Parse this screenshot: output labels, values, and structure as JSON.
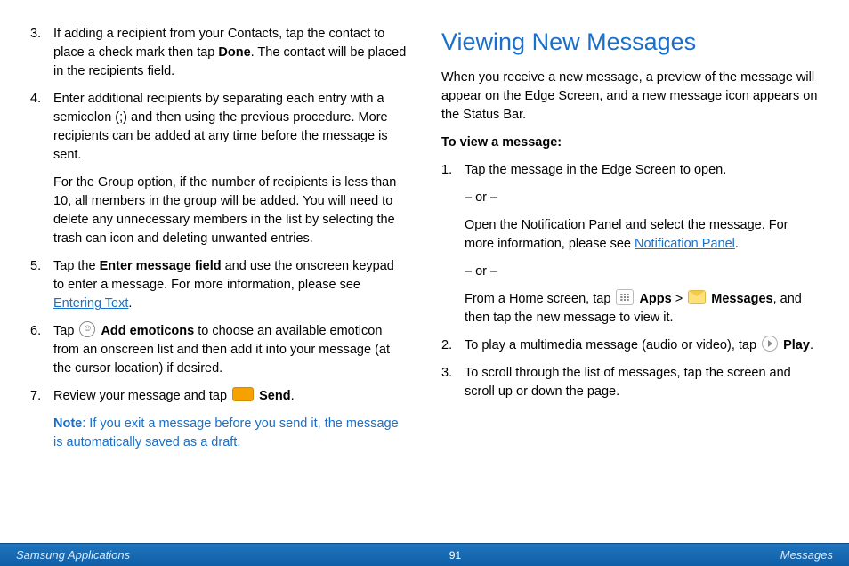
{
  "left": {
    "items": [
      {
        "num": "3.",
        "paras": [
          {
            "runs": [
              {
                "t": "If adding a recipient from your Contacts, tap the contact to place a check mark then tap "
              },
              {
                "t": "Done",
                "bold": true
              },
              {
                "t": ". The contact will be placed in the recipients field."
              }
            ]
          }
        ]
      },
      {
        "num": "4.",
        "paras": [
          {
            "runs": [
              {
                "t": "Enter additional recipients by separating each entry with a semicolon (;) and then using the previous procedure. More recipients can be added at any time before the message is sent."
              }
            ]
          },
          {
            "runs": [
              {
                "t": "For the Group option, if the number of recipients is less than 10, all members in the group will be added. You will need to delete any unnecessary members in the list by selecting the trash can icon and deleting unwanted entries."
              }
            ]
          }
        ]
      },
      {
        "num": "5.",
        "paras": [
          {
            "runs": [
              {
                "t": "Tap the "
              },
              {
                "t": "Enter message field",
                "bold": true
              },
              {
                "t": " and use the onscreen keypad to enter a message. For more information, please see "
              },
              {
                "t": "Entering Text",
                "link": true
              },
              {
                "t": "."
              }
            ]
          }
        ]
      },
      {
        "num": "6.",
        "paras": [
          {
            "runs": [
              {
                "t": "Tap "
              },
              {
                "icon": "emoticon"
              },
              {
                "t": " "
              },
              {
                "t": "Add emoticons",
                "bold": true
              },
              {
                "t": " to choose an available emoticon from an onscreen list and then add it into your message (at the cursor location) if desired."
              }
            ]
          }
        ]
      },
      {
        "num": "7.",
        "paras": [
          {
            "runs": [
              {
                "t": "Review your message and tap "
              },
              {
                "icon": "send"
              },
              {
                "t": " "
              },
              {
                "t": "Send",
                "bold": true
              },
              {
                "t": "."
              }
            ]
          }
        ]
      }
    ],
    "note": {
      "label": "Note",
      "text": ": If you exit a message before you send it, the message is automatically saved as a draft."
    }
  },
  "right": {
    "heading": "Viewing New Messages",
    "intro": "When you receive a new message, a preview of the message will appear on the Edge Screen, and a new message icon appears on the Status Bar.",
    "subheading": "To view a message:",
    "items": [
      {
        "num": "1.",
        "paras": [
          {
            "runs": [
              {
                "t": "Tap the message in the Edge Screen to open."
              }
            ]
          },
          {
            "runs": [
              {
                "t": "– or –"
              }
            ]
          },
          {
            "runs": [
              {
                "t": "Open the Notification Panel and select the message. For more information, please see "
              },
              {
                "t": "Notification Panel",
                "link": true
              },
              {
                "t": "."
              }
            ]
          },
          {
            "runs": [
              {
                "t": "– or –"
              }
            ]
          },
          {
            "runs": [
              {
                "t": "From a Home screen, tap "
              },
              {
                "icon": "apps-grid"
              },
              {
                "t": " "
              },
              {
                "t": "Apps",
                "bold": true
              },
              {
                "t": " > "
              },
              {
                "icon": "messages-envelope"
              },
              {
                "t": " "
              },
              {
                "t": "Messages",
                "bold": true
              },
              {
                "t": ", and then tap the new message to view it."
              }
            ]
          }
        ]
      },
      {
        "num": "2.",
        "paras": [
          {
            "runs": [
              {
                "t": "To play a multimedia message (audio or video), tap "
              },
              {
                "icon": "play"
              },
              {
                "t": " "
              },
              {
                "t": "Play",
                "bold": true
              },
              {
                "t": "."
              }
            ]
          }
        ]
      },
      {
        "num": "3.",
        "paras": [
          {
            "runs": [
              {
                "t": "To scroll through the list of messages, tap the screen and scroll up or down the page."
              }
            ]
          }
        ]
      }
    ]
  },
  "footer": {
    "left": "Samsung Applications",
    "center": "91",
    "right": "Messages"
  },
  "icons": {
    "emoticon": "☺",
    "send": "send",
    "apps-grid": "",
    "messages-envelope": "",
    "play": ""
  }
}
